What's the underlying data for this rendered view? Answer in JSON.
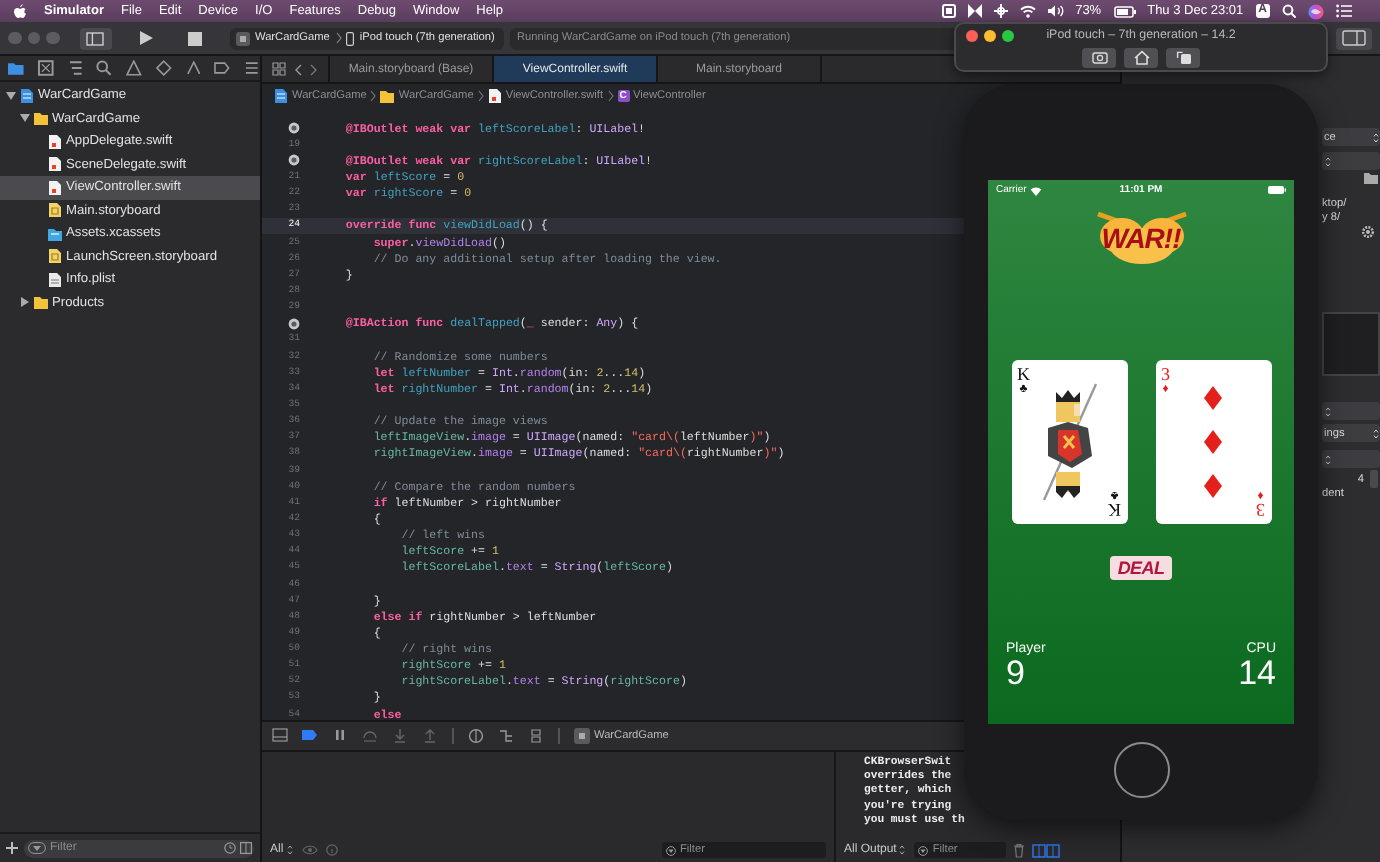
{
  "menu_bar": {
    "app": "Simulator",
    "items": [
      "File",
      "Edit",
      "Device",
      "I/O",
      "Features",
      "Debug",
      "Window",
      "Help"
    ],
    "battery": "73%",
    "clock": "Thu 3 Dec  23:01",
    "input_source": "A"
  },
  "toolbar": {
    "scheme": "WarCardGame",
    "destination": "iPod touch (7th generation)",
    "status": "Running WarCardGame on iPod touch (7th generation)"
  },
  "navigator": {
    "tree": [
      {
        "label": "WarCardGame",
        "kind": "project",
        "expanded": true,
        "selected": false,
        "children": [
          {
            "label": "WarCardGame",
            "kind": "folder",
            "expanded": true,
            "selected": false,
            "children": [
              {
                "label": "AppDelegate.swift",
                "kind": "swift",
                "selected": false
              },
              {
                "label": "SceneDelegate.swift",
                "kind": "swift",
                "selected": false
              },
              {
                "label": "ViewController.swift",
                "kind": "swift",
                "selected": true
              },
              {
                "label": "Main.storyboard",
                "kind": "storyboard",
                "selected": false
              },
              {
                "label": "Assets.xcassets",
                "kind": "assets",
                "selected": false
              },
              {
                "label": "LaunchScreen.storyboard",
                "kind": "storyboard",
                "selected": false
              },
              {
                "label": "Info.plist",
                "kind": "plist",
                "selected": false
              }
            ]
          },
          {
            "label": "Products",
            "kind": "folder",
            "expanded": false,
            "selected": false
          }
        ]
      }
    ],
    "filter_placeholder": "Filter"
  },
  "editor": {
    "tabs": [
      {
        "label": "Main.storyboard (Base)",
        "selected": false
      },
      {
        "label": "ViewController.swift",
        "selected": true
      },
      {
        "label": "Main.storyboard",
        "selected": false
      }
    ],
    "breadcrumb": [
      {
        "label": "WarCardGame",
        "kind": "project"
      },
      {
        "label": "WarCardGame",
        "kind": "folder"
      },
      {
        "label": "ViewController.swift",
        "kind": "swift"
      },
      {
        "label": "ViewController",
        "kind": "class",
        "badge": "C"
      }
    ],
    "lines": [
      {
        "connected": true,
        "current": false,
        "tokens": [
          {
            "kind": "kw",
            "text": "    @IBOutlet weak var "
          },
          {
            "kind": "decl",
            "text": "leftScoreLabel"
          },
          {
            "kind": "plain",
            "text": ": "
          },
          {
            "kind": "type",
            "text": "UILabel"
          },
          {
            "kind": "plain",
            "text": "!"
          }
        ]
      },
      {
        "number": "19",
        "connected": false,
        "current": false
      },
      {
        "connected": true,
        "current": false,
        "tokens": [
          {
            "kind": "kw",
            "text": "    @IBOutlet weak var "
          },
          {
            "kind": "decl",
            "text": "rightScoreLabel"
          },
          {
            "kind": "plain",
            "text": ": "
          },
          {
            "kind": "type",
            "text": "UILabel"
          },
          {
            "kind": "plain",
            "text": "!"
          }
        ]
      },
      {
        "number": "21",
        "connected": false,
        "current": false,
        "tokens": [
          {
            "kind": "kw",
            "text": "    var "
          },
          {
            "kind": "decl",
            "text": "leftScore"
          },
          {
            "kind": "plain",
            "text": " = "
          },
          {
            "kind": "num",
            "text": "0"
          }
        ]
      },
      {
        "number": "22",
        "connected": false,
        "current": false,
        "tokens": [
          {
            "kind": "kw",
            "text": "    var "
          },
          {
            "kind": "decl",
            "text": "rightScore"
          },
          {
            "kind": "plain",
            "text": " = "
          },
          {
            "kind": "num",
            "text": "0"
          }
        ]
      },
      {
        "number": "23",
        "connected": false,
        "current": false
      },
      {
        "number": "24",
        "connected": false,
        "current": true,
        "tokens": [
          {
            "kind": "kw",
            "text": "    override func "
          },
          {
            "kind": "decl",
            "text": "viewDidLoad"
          },
          {
            "kind": "plain",
            "text": "() {"
          }
        ]
      },
      {
        "number": "25",
        "connected": false,
        "current": false,
        "tokens": [
          {
            "kind": "kw",
            "text": "        super"
          },
          {
            "kind": "plain",
            "text": "."
          },
          {
            "kind": "member",
            "text": "viewDidLoad"
          },
          {
            "kind": "plain",
            "text": "()"
          }
        ]
      },
      {
        "number": "26",
        "connected": false,
        "current": false,
        "tokens": [
          {
            "kind": "comment",
            "text": "        // Do any additional setup after loading the view."
          }
        ]
      },
      {
        "number": "27",
        "connected": false,
        "current": false,
        "tokens": [
          {
            "kind": "plain",
            "text": "    }"
          }
        ]
      },
      {
        "number": "28",
        "connected": false,
        "current": false
      },
      {
        "number": "29",
        "connected": false,
        "current": false
      },
      {
        "connected": true,
        "current": false,
        "tokens": [
          {
            "kind": "kw",
            "text": "    @IBAction func "
          },
          {
            "kind": "decl",
            "text": "dealTapped"
          },
          {
            "kind": "plain",
            "text": "("
          },
          {
            "kind": "kw",
            "text": "_"
          },
          {
            "kind": "plain",
            "text": " sender: "
          },
          {
            "kind": "type",
            "text": "Any"
          },
          {
            "kind": "plain",
            "text": ") {"
          }
        ]
      },
      {
        "number": "31",
        "connected": false,
        "current": false
      },
      {
        "number": "32",
        "connected": false,
        "current": false,
        "tokens": [
          {
            "kind": "comment",
            "text": "        // Randomize some numbers"
          }
        ]
      },
      {
        "number": "33",
        "connected": false,
        "current": false,
        "tokens": [
          {
            "kind": "kw",
            "text": "        let "
          },
          {
            "kind": "decl",
            "text": "leftNumber"
          },
          {
            "kind": "plain",
            "text": " = "
          },
          {
            "kind": "type",
            "text": "Int"
          },
          {
            "kind": "plain",
            "text": "."
          },
          {
            "kind": "member",
            "text": "random"
          },
          {
            "kind": "plain",
            "text": "(in: "
          },
          {
            "kind": "num",
            "text": "2"
          },
          {
            "kind": "plain",
            "text": "..."
          },
          {
            "kind": "num",
            "text": "14"
          },
          {
            "kind": "plain",
            "text": ")"
          }
        ]
      },
      {
        "number": "34",
        "connected": false,
        "current": false,
        "tokens": [
          {
            "kind": "kw",
            "text": "        let "
          },
          {
            "kind": "decl",
            "text": "rightNumber"
          },
          {
            "kind": "plain",
            "text": " = "
          },
          {
            "kind": "type",
            "text": "Int"
          },
          {
            "kind": "plain",
            "text": "."
          },
          {
            "kind": "member",
            "text": "random"
          },
          {
            "kind": "plain",
            "text": "(in: "
          },
          {
            "kind": "num",
            "text": "2"
          },
          {
            "kind": "plain",
            "text": "..."
          },
          {
            "kind": "num",
            "text": "14"
          },
          {
            "kind": "plain",
            "text": ")"
          }
        ]
      },
      {
        "number": "35",
        "connected": false,
        "current": false
      },
      {
        "number": "36",
        "connected": false,
        "current": false,
        "tokens": [
          {
            "kind": "comment",
            "text": "        // Update the image views"
          }
        ]
      },
      {
        "number": "37",
        "connected": false,
        "current": false,
        "tokens": [
          {
            "kind": "ident",
            "text": "        leftImageView"
          },
          {
            "kind": "plain",
            "text": "."
          },
          {
            "kind": "member",
            "text": "image"
          },
          {
            "kind": "plain",
            "text": " = "
          },
          {
            "kind": "type",
            "text": "UIImage"
          },
          {
            "kind": "plain",
            "text": "(named: "
          },
          {
            "kind": "str",
            "text": "\"card\\("
          },
          {
            "kind": "plain",
            "text": "leftNumber"
          },
          {
            "kind": "str",
            "text": ")\""
          },
          {
            "kind": "plain",
            "text": ")"
          }
        ]
      },
      {
        "number": "38",
        "connected": false,
        "current": false,
        "tokens": [
          {
            "kind": "ident",
            "text": "        rightImageView"
          },
          {
            "kind": "plain",
            "text": "."
          },
          {
            "kind": "member",
            "text": "image"
          },
          {
            "kind": "plain",
            "text": " = "
          },
          {
            "kind": "type",
            "text": "UIImage"
          },
          {
            "kind": "plain",
            "text": "(named: "
          },
          {
            "kind": "str",
            "text": "\"card\\("
          },
          {
            "kind": "plain",
            "text": "rightNumber"
          },
          {
            "kind": "str",
            "text": ")\""
          },
          {
            "kind": "plain",
            "text": ")"
          }
        ]
      },
      {
        "number": "39",
        "connected": false,
        "current": false
      },
      {
        "number": "40",
        "connected": false,
        "current": false,
        "tokens": [
          {
            "kind": "comment",
            "text": "        // Compare the random numbers"
          }
        ]
      },
      {
        "number": "41",
        "connected": false,
        "current": false,
        "tokens": [
          {
            "kind": "kw",
            "text": "        if "
          },
          {
            "kind": "plain",
            "text": "leftNumber > rightNumber"
          }
        ]
      },
      {
        "number": "42",
        "connected": false,
        "current": false,
        "tokens": [
          {
            "kind": "plain",
            "text": "        {"
          }
        ]
      },
      {
        "number": "43",
        "connected": false,
        "current": false,
        "tokens": [
          {
            "kind": "comment",
            "text": "            // left wins"
          }
        ]
      },
      {
        "number": "44",
        "connected": false,
        "current": false,
        "tokens": [
          {
            "kind": "ident",
            "text": "            leftScore"
          },
          {
            "kind": "plain",
            "text": " += "
          },
          {
            "kind": "num",
            "text": "1"
          }
        ]
      },
      {
        "number": "45",
        "connected": false,
        "current": false,
        "tokens": [
          {
            "kind": "ident",
            "text": "            leftScoreLabel"
          },
          {
            "kind": "plain",
            "text": "."
          },
          {
            "kind": "member",
            "text": "text"
          },
          {
            "kind": "plain",
            "text": " = "
          },
          {
            "kind": "type",
            "text": "String"
          },
          {
            "kind": "plain",
            "text": "("
          },
          {
            "kind": "ident",
            "text": "leftScore"
          },
          {
            "kind": "plain",
            "text": ")"
          }
        ]
      },
      {
        "number": "46",
        "connected": false,
        "current": false
      },
      {
        "number": "47",
        "connected": false,
        "current": false,
        "tokens": [
          {
            "kind": "plain",
            "text": "        }"
          }
        ]
      },
      {
        "number": "48",
        "connected": false,
        "current": false,
        "tokens": [
          {
            "kind": "kw",
            "text": "        else if "
          },
          {
            "kind": "plain",
            "text": "rightNumber > leftNumber"
          }
        ]
      },
      {
        "number": "49",
        "connected": false,
        "current": false,
        "tokens": [
          {
            "kind": "plain",
            "text": "        {"
          }
        ]
      },
      {
        "number": "50",
        "connected": false,
        "current": false,
        "tokens": [
          {
            "kind": "comment",
            "text": "            // right wins"
          }
        ]
      },
      {
        "number": "51",
        "connected": false,
        "current": false,
        "tokens": [
          {
            "kind": "ident",
            "text": "            rightScore"
          },
          {
            "kind": "plain",
            "text": " += "
          },
          {
            "kind": "num",
            "text": "1"
          }
        ]
      },
      {
        "number": "52",
        "connected": false,
        "current": false,
        "tokens": [
          {
            "kind": "ident",
            "text": "            rightScoreLabel"
          },
          {
            "kind": "plain",
            "text": "."
          },
          {
            "kind": "member",
            "text": "text"
          },
          {
            "kind": "plain",
            "text": " = "
          },
          {
            "kind": "type",
            "text": "String"
          },
          {
            "kind": "plain",
            "text": "("
          },
          {
            "kind": "ident",
            "text": "rightScore"
          },
          {
            "kind": "plain",
            "text": ")"
          }
        ]
      },
      {
        "number": "53",
        "connected": false,
        "current": false,
        "tokens": [
          {
            "kind": "plain",
            "text": "        }"
          }
        ]
      },
      {
        "number": "54",
        "connected": false,
        "current": false,
        "tokens": [
          {
            "kind": "kw",
            "text": "        else"
          }
        ]
      }
    ]
  },
  "debug_bar": {
    "target": "WarCardGame"
  },
  "variables": {
    "scope": "All",
    "filter_placeholder": "Filter"
  },
  "console": {
    "lines": [
      "CKBrowserSwit",
      "overrides the",
      "getter, which",
      "you're trying",
      "you must use th"
    ],
    "scope": "All Output",
    "filter_placeholder": "Filter"
  },
  "inspector": {
    "rows": [
      {
        "kind": "popup",
        "text": "ce"
      },
      {
        "kind": "popup"
      },
      {
        "kind": "folder"
      },
      {
        "kind": "text",
        "text": "ktop/"
      },
      {
        "kind": "text",
        "text": "y 8/"
      },
      {
        "kind": "gear"
      },
      {
        "kind": "box"
      },
      {
        "kind": "popup"
      },
      {
        "kind": "popup",
        "text": "ings"
      },
      {
        "kind": "popup"
      },
      {
        "kind": "stepper",
        "text": "4"
      },
      {
        "kind": "text",
        "text": "dent"
      }
    ]
  },
  "simulator": {
    "title": "iPod touch – 7th generation – 14.2",
    "carrier": "Carrier",
    "time": "11:01 PM",
    "logo": "WAR!!",
    "cards": [
      {
        "kind": "king",
        "color": "#111111",
        "corner_top": {
          "rank": "K",
          "suit": "♣"
        },
        "corner_bottom": {
          "rank": "K",
          "suit": "♣"
        }
      },
      {
        "kind": "pips",
        "color": "#e3201b",
        "corner_top": {
          "rank": "3",
          "suit": "♦"
        },
        "corner_bottom": {
          "rank": "3",
          "suit": "♦"
        }
      }
    ],
    "deal": "DEAL",
    "player": {
      "label": "Player",
      "score": "9"
    },
    "cpu": {
      "label": "CPU",
      "score": "14"
    }
  }
}
